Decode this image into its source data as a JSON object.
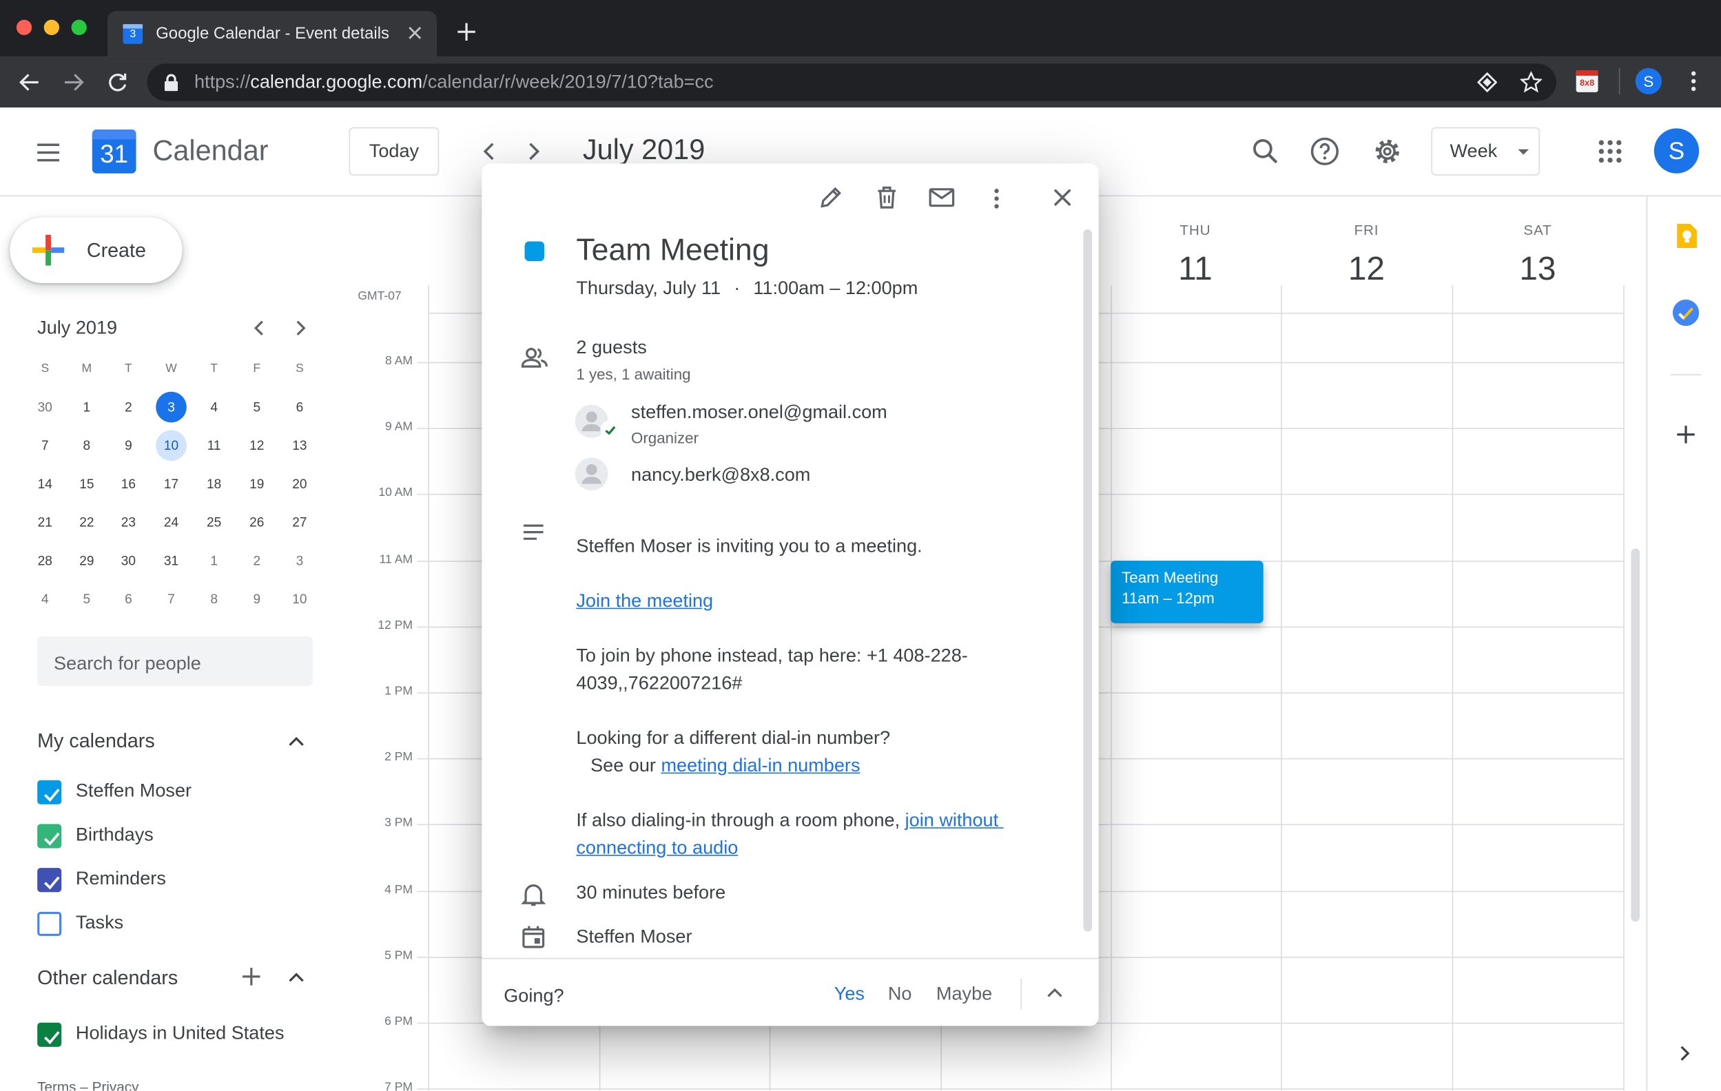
{
  "browser": {
    "tab_title": "Google Calendar - Event details",
    "url_scheme": "https://",
    "url_host": "calendar.google.com",
    "url_path": "/calendar/r/week/2019/7/10?tab=cc",
    "profile_initial": "S",
    "extension_label": "8x8"
  },
  "header": {
    "app_name": "Calendar",
    "logo_day": "31",
    "today_label": "Today",
    "period_title": "July 2019",
    "view_label": "Week",
    "avatar_initial": "S"
  },
  "sidebar": {
    "create_label": "Create",
    "mini_month": "July 2019",
    "weekdays": [
      "S",
      "M",
      "T",
      "W",
      "T",
      "F",
      "S"
    ],
    "weeks": [
      [
        "30",
        "1",
        "2",
        "3",
        "4",
        "5",
        "6"
      ],
      [
        "7",
        "8",
        "9",
        "10",
        "11",
        "12",
        "13"
      ],
      [
        "14",
        "15",
        "16",
        "17",
        "18",
        "19",
        "20"
      ],
      [
        "21",
        "22",
        "23",
        "24",
        "25",
        "26",
        "27"
      ],
      [
        "28",
        "29",
        "30",
        "31",
        "1",
        "2",
        "3"
      ],
      [
        "4",
        "5",
        "6",
        "7",
        "8",
        "9",
        "10"
      ]
    ],
    "search_placeholder": "Search for people",
    "my_calendars_title": "My calendars",
    "my_calendars": [
      {
        "label": "Steffen Moser",
        "color": "#039be5",
        "checked": true
      },
      {
        "label": "Birthdays",
        "color": "#33b679",
        "checked": true
      },
      {
        "label": "Reminders",
        "color": "#3f51b5",
        "checked": true
      },
      {
        "label": "Tasks",
        "color": "#4285f4",
        "checked": false
      }
    ],
    "other_calendars_title": "Other calendars",
    "other_calendars": [
      {
        "label": "Holidays in United States",
        "color": "#0b8043",
        "checked": true
      }
    ],
    "footer": "Terms – Privacy"
  },
  "grid": {
    "timezone": "GMT-07",
    "days": [
      {
        "name": "THU",
        "num": "11"
      },
      {
        "name": "FRI",
        "num": "12"
      },
      {
        "name": "SAT",
        "num": "13"
      }
    ],
    "hours": [
      "8 AM",
      "9 AM",
      "10 AM",
      "11 AM",
      "12 PM",
      "1 PM",
      "2 PM",
      "3 PM",
      "4 PM",
      "5 PM",
      "6 PM",
      "7 PM"
    ],
    "event": {
      "title": "Team Meeting",
      "time": "11am – 12pm",
      "color": "#039be5"
    }
  },
  "popup": {
    "title": "Team Meeting",
    "date": "Thursday, July 11",
    "time": "11:00am – 12:00pm",
    "event_color": "#039be5",
    "guests_count": "2 guests",
    "guests_status": "1 yes, 1 awaiting",
    "guests": [
      {
        "email": "steffen.moser.onel@gmail.com",
        "role": "Organizer"
      },
      {
        "email": "nancy.berk@8x8.com",
        "role": ""
      }
    ],
    "description": {
      "intro": "Steffen Moser is inviting you to a meeting.",
      "join_link": "Join the meeting",
      "phone_line1": "To join by phone instead, tap here: +1 408-228-",
      "phone_line2": "4039,,7622007216#",
      "dialin_q": "Looking for a different dial-in number?",
      "dialin_prefix": "See our ",
      "dialin_link": "meeting dial-in numbers",
      "room_prefix": "If also dialing-in through a room phone, ",
      "room_link1": "join without ",
      "room_link2": "connecting to audio"
    },
    "reminder": "30 minutes before",
    "calendar_owner": "Steffen Moser",
    "rsvp_question": "Going?",
    "rsvp_yes": "Yes",
    "rsvp_no": "No",
    "rsvp_maybe": "Maybe"
  }
}
